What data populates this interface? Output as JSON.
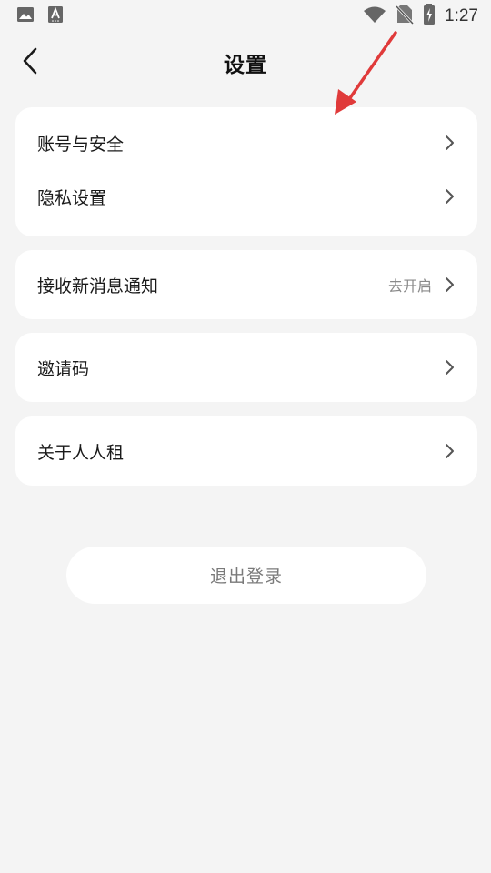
{
  "status_bar": {
    "time": "1:27",
    "icons": [
      "image-icon",
      "text-a-icon",
      "wifi-icon",
      "no-sim-icon",
      "battery-charging-icon"
    ]
  },
  "header": {
    "title": "设置",
    "back_icon": "chevron-left-icon"
  },
  "groups": [
    {
      "items": [
        {
          "label": "账号与安全"
        },
        {
          "label": "隐私设置"
        }
      ]
    },
    {
      "items": [
        {
          "label": "接收新消息通知",
          "value": "去开启"
        }
      ]
    },
    {
      "items": [
        {
          "label": "邀请码"
        }
      ]
    },
    {
      "items": [
        {
          "label": "关于人人租"
        }
      ]
    }
  ],
  "logout": {
    "label": "退出登录"
  },
  "colors": {
    "background": "#f4f4f4",
    "card": "#ffffff",
    "annotation_arrow": "#e03a3a"
  }
}
